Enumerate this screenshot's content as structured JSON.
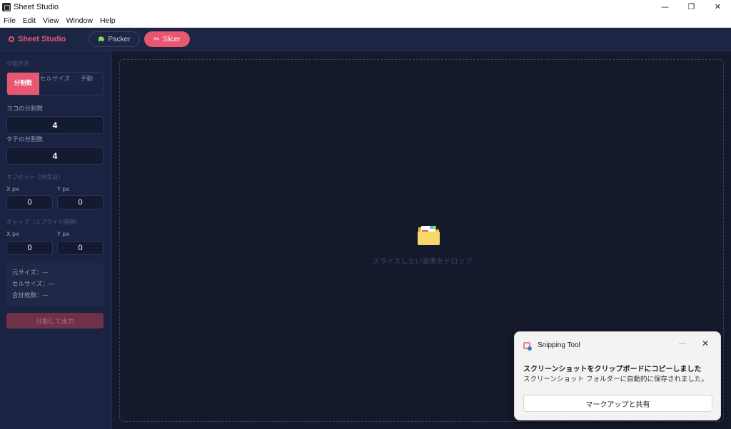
{
  "window": {
    "title": "Sheet Studio",
    "controls": {
      "minimize": "—",
      "restore": "❐",
      "close": "✕"
    }
  },
  "menu": [
    "File",
    "Edit",
    "View",
    "Window",
    "Help"
  ],
  "header": {
    "brand": "Sheet Studio",
    "modes": [
      {
        "label": "Packer",
        "icon": "puzzle-icon",
        "active": false
      },
      {
        "label": "Slicer",
        "icon": "scissors-icon",
        "active": true
      }
    ]
  },
  "sidebar": {
    "split_method_label": "分割方法",
    "split_methods": [
      "分割数",
      "セルサイズ",
      "手動"
    ],
    "active_method": "分割数",
    "cols_label": "ヨコの分割数",
    "cols_value": "4",
    "rows_label": "タテの分割数",
    "rows_value": "4",
    "offset_label": "オフセット（枠余白）",
    "offset": {
      "x_label": "X px",
      "x_value": "0",
      "y_label": "Y px",
      "y_value": "0"
    },
    "gap_label": "ギャップ（スプライト間隔）",
    "gap": {
      "x_label": "X px",
      "x_value": "0",
      "y_label": "Y px",
      "y_value": "0"
    },
    "info": {
      "original_size": "元サイズ：—",
      "cell_size": "セルサイズ：—",
      "total_count": "合計枚数：—"
    },
    "export_label": "分割して出力"
  },
  "main": {
    "drop_icon": "folder-icon",
    "drop_text": "スライスしたい画像をドロップ"
  },
  "toast": {
    "app_name": "Snipping Tool",
    "more": "···",
    "close": "✕",
    "title": "スクリーンショットをクリップボードにコピーしました",
    "body": "スクリーンショット フォルダーに自動的に保存されました。",
    "action": "マークアップと共有"
  },
  "colors": {
    "accent": "#e8566f",
    "sidebar_bg": "#1b2342",
    "main_bg": "#141a2c"
  }
}
